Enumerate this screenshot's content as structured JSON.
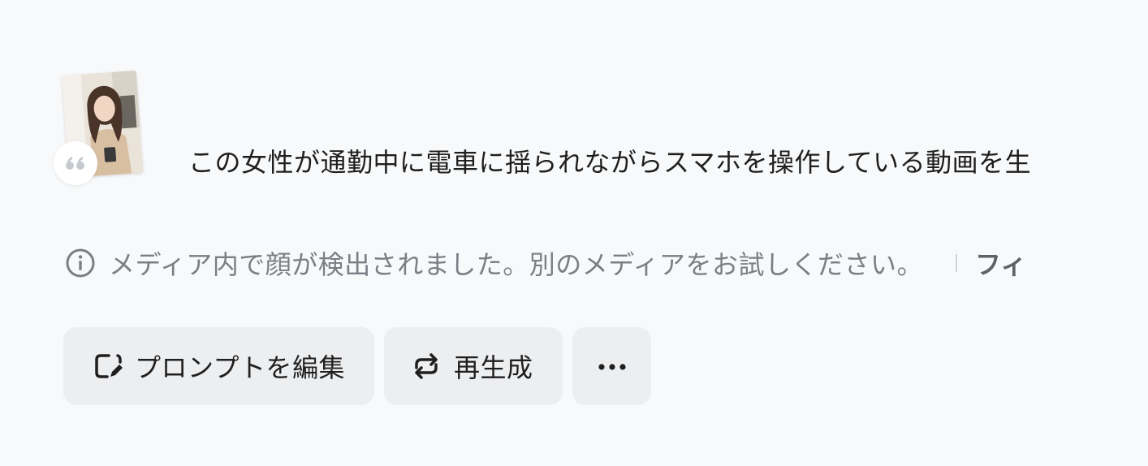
{
  "prompt": {
    "text": "この女性が通勤中に電車に揺られながらスマホを操作している動画を生",
    "thumbnail_icon": "woman-photo-thumbnail",
    "badge_icon": "quote-icon"
  },
  "notice": {
    "icon": "info-icon",
    "message": "メディア内で顔が検出されました。別のメディアをお試しください。",
    "link_text": "フィ"
  },
  "actions": {
    "edit_prompt_label": "プロンプトを編集",
    "edit_prompt_icon": "edit-icon",
    "regenerate_label": "再生成",
    "regenerate_icon": "regenerate-icon",
    "more_icon": "more-icon"
  },
  "colors": {
    "background": "#f8f9fa",
    "button_bg": "#edeef0",
    "notice_text": "#7a7f85"
  }
}
